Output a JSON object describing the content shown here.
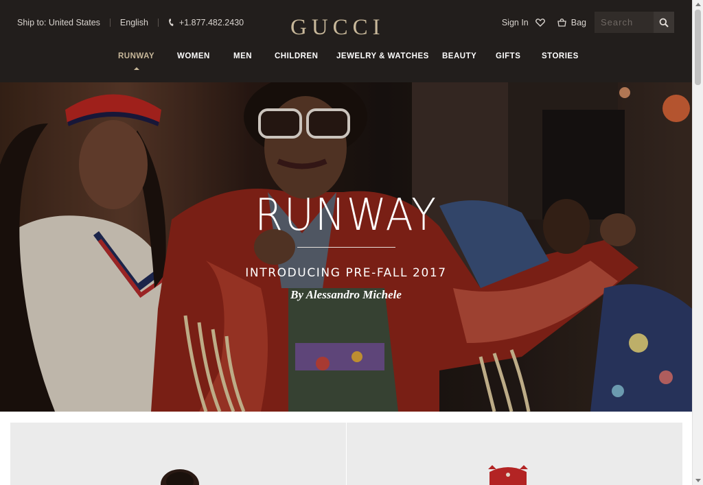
{
  "header": {
    "ship_to": "Ship to: United States",
    "language": "English",
    "phone": "+1.877.482.2430",
    "logo": "GUCCI",
    "sign_in": "Sign In",
    "bag": "Bag",
    "search_placeholder": "Search"
  },
  "nav": {
    "items": [
      {
        "label": "RUNWAY",
        "active": true
      },
      {
        "label": "WOMEN"
      },
      {
        "label": "MEN"
      },
      {
        "label": "CHILDREN"
      },
      {
        "label": "JEWELRY & WATCHES"
      },
      {
        "label": "BEAUTY"
      },
      {
        "label": "GIFTS"
      },
      {
        "label": "STORIES"
      }
    ]
  },
  "hero": {
    "title": "RUNWAY",
    "subtitle": "INTRODUCING PRE-FALL 2017",
    "byline": "By Alessandro Michele"
  },
  "colors": {
    "header_bg": "#221e1c",
    "accent_gold": "#c8b89a",
    "tile_bg": "#ebebeb"
  },
  "icons": [
    "phone-icon",
    "heart-icon",
    "bag-icon",
    "search-icon",
    "chevron-up-icon",
    "chevron-down-icon"
  ]
}
